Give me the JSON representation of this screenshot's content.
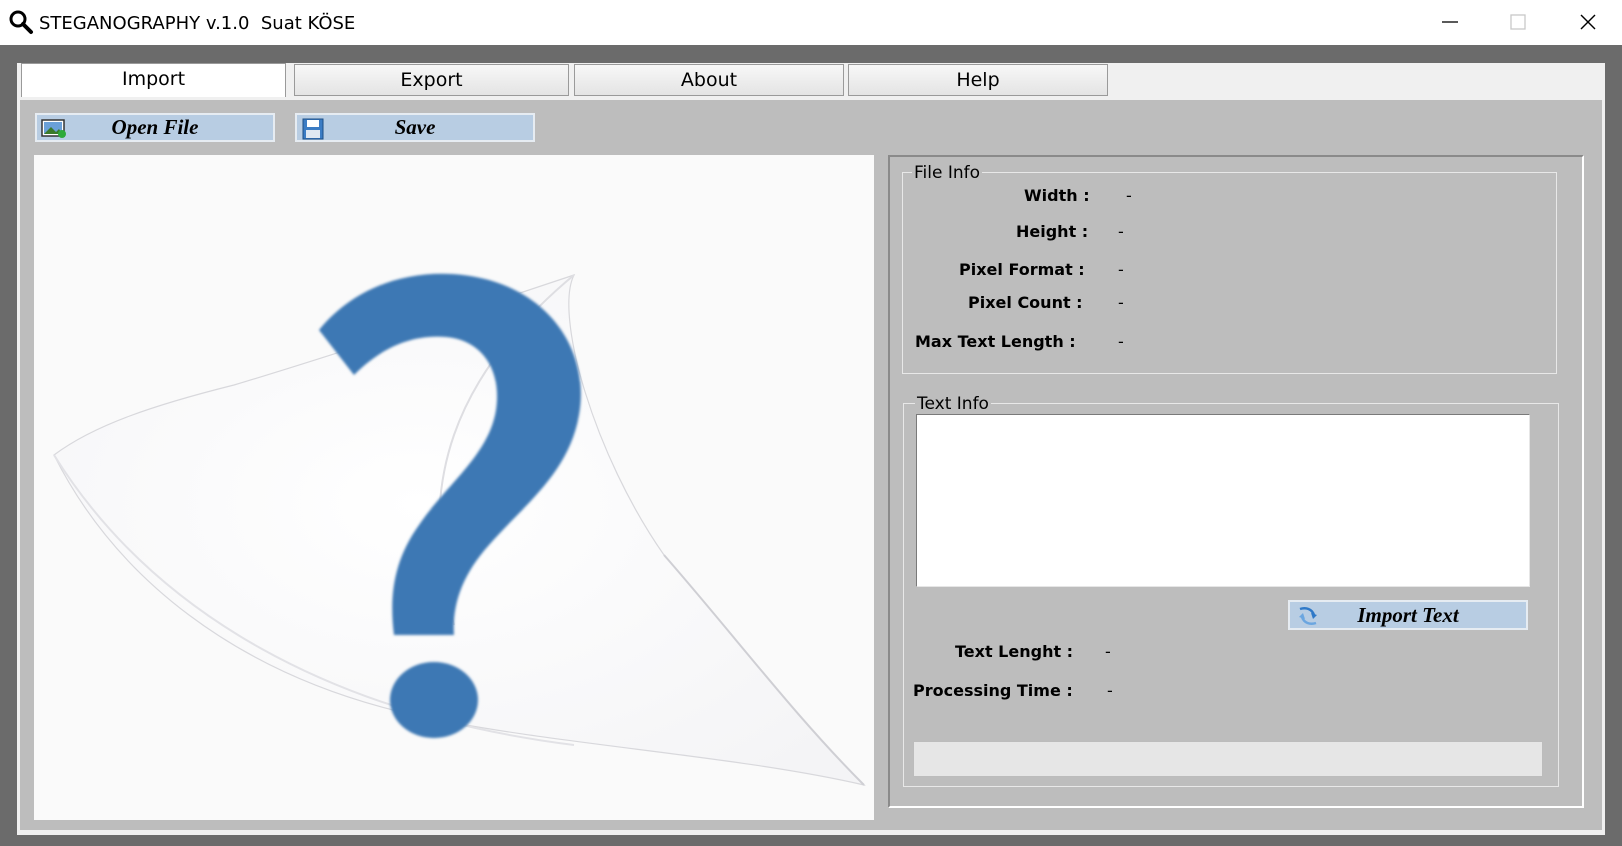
{
  "window": {
    "title": "STEGANOGRAPHY v.1.0  Suat KÖSE"
  },
  "tabs": [
    {
      "label": "Import",
      "active": true
    },
    {
      "label": "Export",
      "active": false
    },
    {
      "label": "About",
      "active": false
    },
    {
      "label": "Help",
      "active": false
    }
  ],
  "toolbar": {
    "open_label": "Open File",
    "save_label": "Save"
  },
  "file_info": {
    "title": "File Info",
    "width_label": "Width :",
    "width_value": "-",
    "height_label": "Height :",
    "height_value": "-",
    "pixel_format_label": "Pixel Format :",
    "pixel_format_value": "-",
    "pixel_count_label": "Pixel Count :",
    "pixel_count_value": "-",
    "max_text_label": "Max Text Length :",
    "max_text_value": "-"
  },
  "text_info": {
    "title": "Text Info",
    "text_value": "",
    "import_label": "Import Text",
    "length_label": "Text Lenght :",
    "length_value": "-",
    "time_label": "Processing Time :",
    "time_value": "-",
    "progress": 0
  },
  "colors": {
    "button_fill": "#b8cde3",
    "panel_bg": "#bdbdbd",
    "frame": "#6b6b6b",
    "question_mark": "#3d78b4"
  },
  "icons": [
    "search-icon",
    "minimize-icon",
    "maximize-icon",
    "close-icon",
    "image-icon",
    "floppy-disk-icon",
    "import-text-icon",
    "question-mark-image"
  ]
}
